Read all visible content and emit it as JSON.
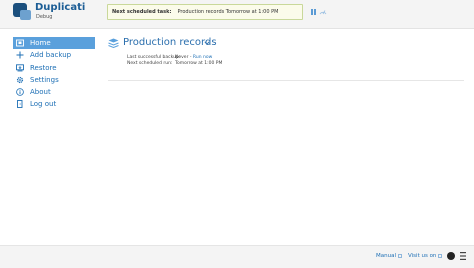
{
  "header": {
    "app_name": "Duplicati",
    "app_subtitle": "Debug",
    "scheduled_label": "Next scheduled task:",
    "scheduled_value": "Production records Tomorrow at 1:00 PM"
  },
  "sidebar": {
    "items": [
      {
        "label": "Home",
        "icon": "home-icon"
      },
      {
        "label": "Add backup",
        "icon": "plus-icon"
      },
      {
        "label": "Restore",
        "icon": "restore-icon"
      },
      {
        "label": "Settings",
        "icon": "gear-icon"
      },
      {
        "label": "About",
        "icon": "info-icon"
      },
      {
        "label": "Log out",
        "icon": "logout-icon"
      }
    ]
  },
  "backup": {
    "name": "Production records",
    "last_label": "Last successful backup:",
    "last_value": "Never",
    "run_now": "Run now",
    "next_label": "Next scheduled run:",
    "next_value": "Tomorrow at 1:00 PM"
  },
  "footer": {
    "manual": "Manual",
    "visit": "Visit us on"
  },
  "colors": {
    "accent": "#5aa0dc",
    "link": "#1d6fb5",
    "brand": "#1b4f7d"
  }
}
